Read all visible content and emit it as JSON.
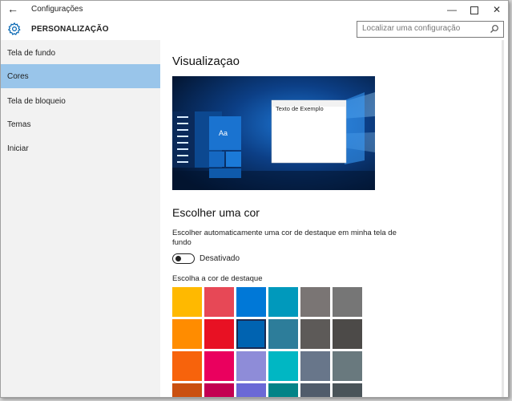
{
  "window": {
    "title": "Configurações",
    "back_icon": "back-arrow-icon",
    "minimize_glyph": "—",
    "close_glyph": "✕"
  },
  "header": {
    "title": "PERSONALIZAÇÃO",
    "icon": "gear-icon",
    "search_placeholder": "Localizar uma configuração"
  },
  "sidebar": {
    "items": [
      {
        "label": "Tela de fundo",
        "active": false
      },
      {
        "label": "Cores",
        "active": true
      },
      {
        "label": "Tela de bloqueio",
        "active": false
      },
      {
        "label": "Temas",
        "active": false
      },
      {
        "label": "Iniciar",
        "active": false
      }
    ]
  },
  "main": {
    "preview_heading": "Visualizaçao",
    "preview": {
      "sample_text": "Texto de Exemplo",
      "tile_text": "Aa"
    },
    "choose_heading": "Escolher uma cor",
    "auto_accent_text": "Escolher automaticamente uma cor de destaque em minha tela de fundo",
    "toggle": {
      "state": "off",
      "label": "Desativado"
    },
    "accent_label": "Escolha a cor de destaque",
    "swatch_colors": [
      [
        "#ffb900",
        "#e74856",
        "#0078d7",
        "#0099bc",
        "#7a7574",
        "#767676"
      ],
      [
        "#ff8c00",
        "#e81123",
        "#0063b1",
        "#2d7d9a",
        "#5d5a58",
        "#4c4a48"
      ],
      [
        "#f7630c",
        "#ea005e",
        "#8e8cd8",
        "#00b7c3",
        "#68768a",
        "#69797e"
      ],
      [
        "#ca5010",
        "#c30052",
        "#6b69d6",
        "#038387",
        "#515c6b",
        "#4a5459"
      ]
    ],
    "selected_swatch": "2-1"
  },
  "colors": {
    "accent": "#0078d7",
    "sidebar_active": "#99c5ea",
    "sidebar_bg": "#f2f2f2"
  }
}
